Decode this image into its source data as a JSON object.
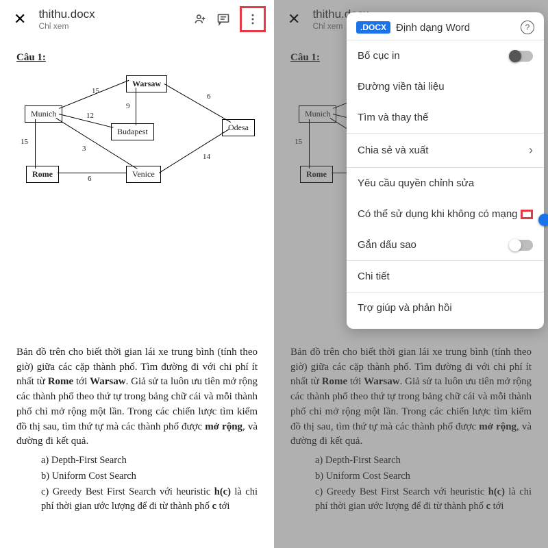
{
  "header": {
    "doc_title": "thithu.docx",
    "subtitle": "Chỉ xem"
  },
  "document": {
    "question_label": "Câu 1:",
    "nodes": {
      "warsaw": "Warsaw",
      "munich": "Munich",
      "budapest": "Budapest",
      "odesa": "Odesa",
      "rome": "Rome",
      "venice": "Venice"
    },
    "edges": {
      "mw": "15",
      "mb": "12",
      "wb": "9",
      "wo": "6",
      "mr": "15",
      "mv": "3",
      "rv": "6",
      "vo": "14"
    },
    "para_1": "Bản đồ trên cho biết thời gian lái xe trung bình (tính theo giờ) giữa các cặp thành phố. Tìm đường đi với chi phí ít nhất từ ",
    "para_rome": "Rome",
    "para_2": " tới ",
    "para_warsaw": "Warsaw",
    "para_3": ". Giả sử ta luôn ưu tiên mở rộng các thành phố theo thứ tự trong bảng chữ cái và mỗi thành phố chỉ mở rộng một lần. Trong các chiến lược tìm kiếm đồ thị sau, tìm thứ tự mà các thành phố được ",
    "para_bold": "mở rộng",
    "para_4": ", và đường đi kết quả.",
    "opt_a": "a)  Depth-First Search",
    "opt_b": "b)  Uniform Cost Search",
    "opt_c_1": "c)  Greedy  Best  First  Search  với heuristic ",
    "opt_c_hc": "h(c)",
    "opt_c_2": " là chi phí thời gian ước lượng để đi từ  thành phố ",
    "opt_c_c": "c",
    "opt_c_3": " tới"
  },
  "menu": {
    "badge": ".DOCX",
    "title": "Định dạng Word",
    "items": {
      "print_layout": "Bố cục in",
      "doc_outline": "Đường viền tài liệu",
      "find_replace": "Tìm và thay thế",
      "share_export": "Chia sẻ và xuất",
      "request_edit": "Yêu cầu quyền chỉnh sửa",
      "offline": "Có thể sử dụng khi không có mạng",
      "star": "Gắn dấu sao",
      "details": "Chi tiết",
      "help": "Trợ giúp và phản hồi"
    }
  }
}
